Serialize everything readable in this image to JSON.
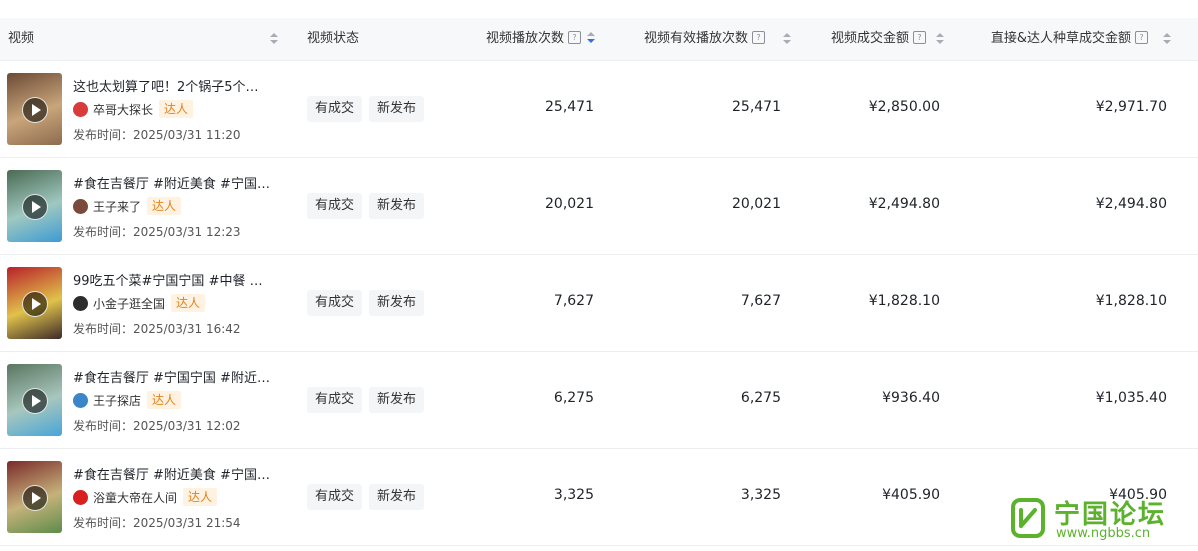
{
  "headers": {
    "video": "视频",
    "status": "视频状态",
    "plays": "视频播放次数",
    "valid_plays": "视频有效播放次数",
    "deal_amount": "视频成交金额",
    "direct_amount": "直接&达人种草成交金额",
    "help_glyph": "?"
  },
  "rows": [
    {
      "title": "这也太划算了吧！2个锅子5个…",
      "author": "卒哥大探长",
      "daren": "达人",
      "pubtime": "发布时间：2025/03/31 11:20",
      "tags": [
        "有成交",
        "新发布"
      ],
      "plays": "25,471",
      "valid_plays": "25,471",
      "deal_amount": "¥2,850.00",
      "direct_amount": "¥2,971.70",
      "avatar_color": "#d93a3a",
      "thumb_colors": [
        "#6b4a35",
        "#c9a57a",
        "#8c6b4f"
      ]
    },
    {
      "title": "#食在吉餐厅 #附近美食 #宁国…",
      "author": "王子来了",
      "daren": "达人",
      "pubtime": "发布时间：2025/03/31 12:23",
      "tags": [
        "有成交",
        "新发布"
      ],
      "plays": "20,021",
      "valid_plays": "20,021",
      "deal_amount": "¥2,494.80",
      "direct_amount": "¥2,494.80",
      "avatar_color": "#7a4a3a",
      "thumb_colors": [
        "#4a6a52",
        "#9fc8c0",
        "#3d9bd3"
      ]
    },
    {
      "title": "99吃五个菜#宁国宁国 #中餐 …",
      "author": "小金子逛全国",
      "daren": "达人",
      "pubtime": "发布时间：2025/03/31 16:42",
      "tags": [
        "有成交",
        "新发布"
      ],
      "plays": "7,627",
      "valid_plays": "7,627",
      "deal_amount": "¥1,828.10",
      "direct_amount": "¥1,828.10",
      "avatar_color": "#2d2d2d",
      "thumb_colors": [
        "#b8202a",
        "#e0c24a",
        "#3b2a2a"
      ]
    },
    {
      "title": "#食在吉餐厅 #宁国宁国 #附近…",
      "author": "王子探店",
      "daren": "达人",
      "pubtime": "发布时间：2025/03/31 12:02",
      "tags": [
        "有成交",
        "新发布"
      ],
      "plays": "6,275",
      "valid_plays": "6,275",
      "deal_amount": "¥936.40",
      "direct_amount": "¥1,035.40",
      "avatar_color": "#3a86c8",
      "thumb_colors": [
        "#5a7560",
        "#a7c7bd",
        "#48a5d8"
      ]
    },
    {
      "title": "#食在吉餐厅 #附近美食 #宁国…",
      "author": "浴童大帝在人间",
      "daren": "达人",
      "pubtime": "发布时间：2025/03/31 21:54",
      "tags": [
        "有成交",
        "新发布"
      ],
      "plays": "3,325",
      "valid_plays": "3,325",
      "deal_amount": "¥405.90",
      "direct_amount": "¥405.90",
      "avatar_color": "#d82020",
      "thumb_colors": [
        "#7a2a2a",
        "#c6b27a",
        "#5c8c4a"
      ]
    }
  ],
  "brand": {
    "name": "宁国论坛",
    "url": "www.ngbbs.cn",
    "color": "#5db22d"
  }
}
